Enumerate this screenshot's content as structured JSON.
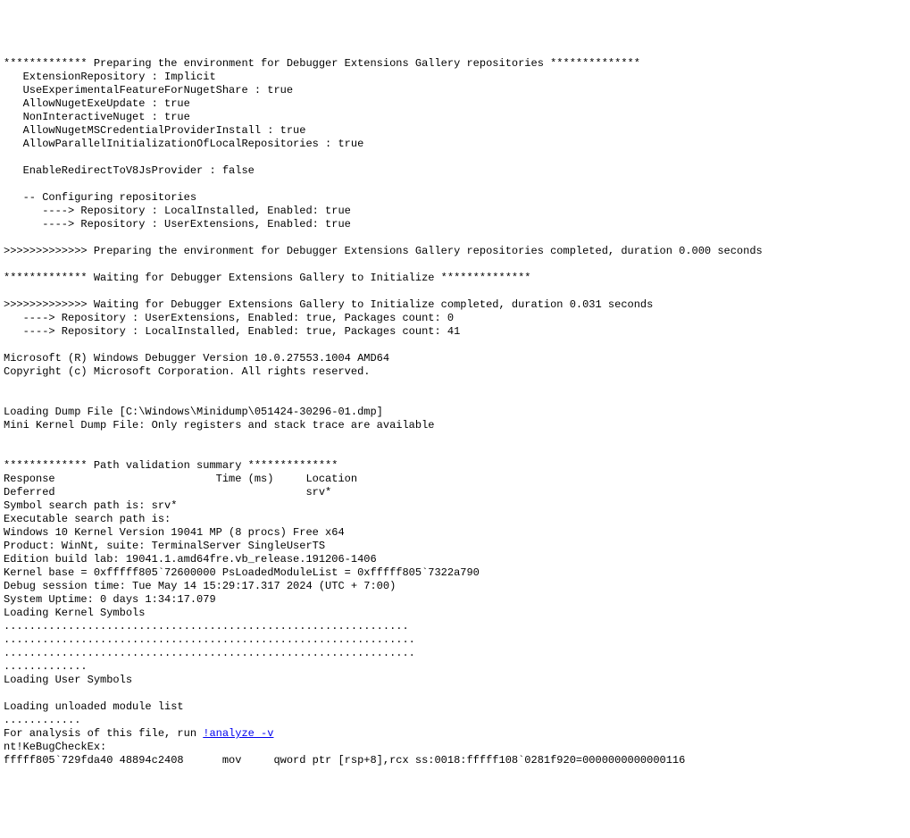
{
  "lines": {
    "l01": "************* Preparing the environment for Debugger Extensions Gallery repositories **************",
    "l02": "   ExtensionRepository : Implicit",
    "l03": "   UseExperimentalFeatureForNugetShare : true",
    "l04": "   AllowNugetExeUpdate : true",
    "l05": "   NonInteractiveNuget : true",
    "l06": "   AllowNugetMSCredentialProviderInstall : true",
    "l07": "   AllowParallelInitializationOfLocalRepositories : true",
    "l08": "",
    "l09": "   EnableRedirectToV8JsProvider : false",
    "l10": "",
    "l11": "   -- Configuring repositories",
    "l12": "      ----> Repository : LocalInstalled, Enabled: true",
    "l13": "      ----> Repository : UserExtensions, Enabled: true",
    "l14": "",
    "l15": ">>>>>>>>>>>>> Preparing the environment for Debugger Extensions Gallery repositories completed, duration 0.000 seconds",
    "l16": "",
    "l17": "************* Waiting for Debugger Extensions Gallery to Initialize **************",
    "l18": "",
    "l19": ">>>>>>>>>>>>> Waiting for Debugger Extensions Gallery to Initialize completed, duration 0.031 seconds",
    "l20": "   ----> Repository : UserExtensions, Enabled: true, Packages count: 0",
    "l21": "   ----> Repository : LocalInstalled, Enabled: true, Packages count: 41",
    "l22": "",
    "l23": "Microsoft (R) Windows Debugger Version 10.0.27553.1004 AMD64",
    "l24": "Copyright (c) Microsoft Corporation. All rights reserved.",
    "l25": "",
    "l26": "",
    "l27": "Loading Dump File [C:\\Windows\\Minidump\\051424-30296-01.dmp]",
    "l28": "Mini Kernel Dump File: Only registers and stack trace are available",
    "l29": "",
    "l30": "",
    "l31": "************* Path validation summary **************",
    "l32": "Response                         Time (ms)     Location",
    "l33": "Deferred                                       srv*",
    "l34": "Symbol search path is: srv*",
    "l35": "Executable search path is: ",
    "l36": "Windows 10 Kernel Version 19041 MP (8 procs) Free x64",
    "l37": "Product: WinNt, suite: TerminalServer SingleUserTS",
    "l38": "Edition build lab: 19041.1.amd64fre.vb_release.191206-1406",
    "l39": "Kernel base = 0xfffff805`72600000 PsLoadedModuleList = 0xfffff805`7322a790",
    "l40": "Debug session time: Tue May 14 15:29:17.317 2024 (UTC + 7:00)",
    "l41": "System Uptime: 0 days 1:34:17.079",
    "l42": "Loading Kernel Symbols",
    "l43": "...............................................................",
    "l44": "................................................................",
    "l45": "................................................................",
    "l46": ".............",
    "l47": "Loading User Symbols",
    "l48": "",
    "l49": "Loading unloaded module list",
    "l50": "............",
    "l51a": "For analysis of this file, run ",
    "l51b": "!analyze -v",
    "l52": "nt!KeBugCheckEx:",
    "l53": "fffff805`729fda40 48894c2408      mov     qword ptr [rsp+8],rcx ss:0018:fffff108`0281f920=0000000000000116"
  }
}
